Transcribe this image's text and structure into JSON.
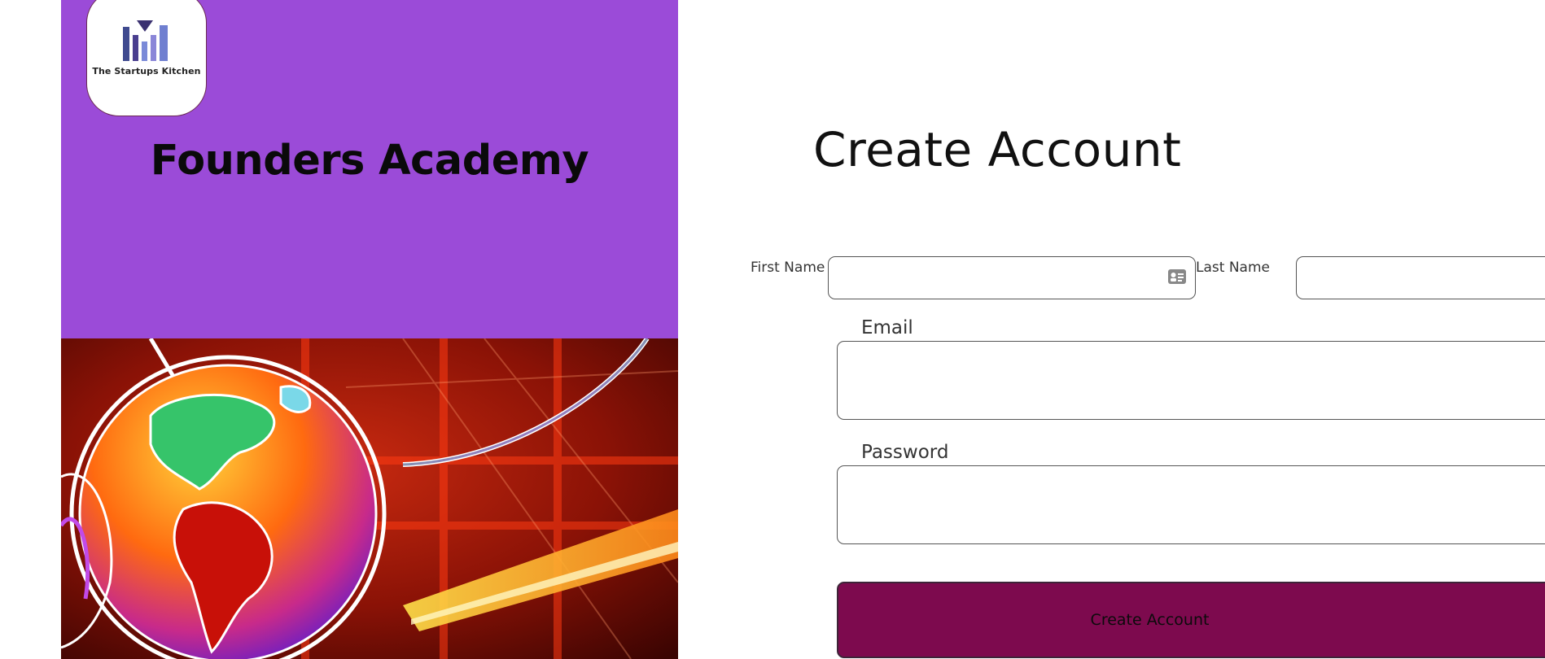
{
  "brand": {
    "logo_text": "The Startups Kitchen",
    "title": "Founders Academy",
    "accent_color": "#9b4bd8"
  },
  "form": {
    "title": "Create Account",
    "first_name_label": "First Name",
    "last_name_label": "Last Name",
    "email_label": "Email",
    "password_label": "Password",
    "first_name_value": "",
    "last_name_value": "",
    "email_value": "",
    "password_value": "",
    "submit_label": "Create Account",
    "submit_color": "#7d0a4e"
  },
  "icons": {
    "first_name_field": "contact-card-icon"
  }
}
